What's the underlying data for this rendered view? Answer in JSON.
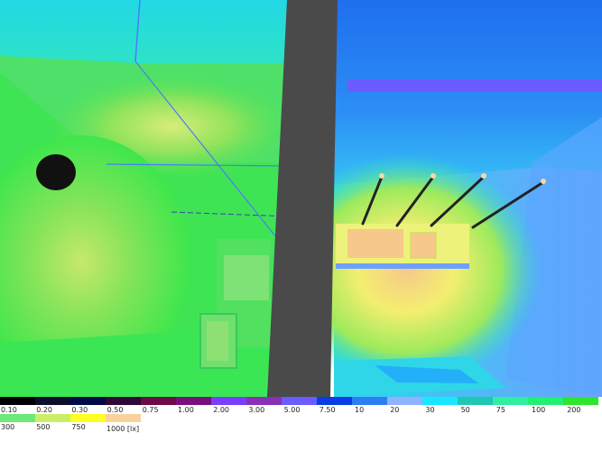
{
  "legend": {
    "unit_label": "1000 [lx]",
    "row1": [
      {
        "label": "0.10",
        "color": "#000000"
      },
      {
        "label": "0.20",
        "color": "#0d0d2e"
      },
      {
        "label": "0.30",
        "color": "#000a46"
      },
      {
        "label": "0.50",
        "color": "#2e0836"
      },
      {
        "label": "0.75",
        "color": "#6c0a48"
      },
      {
        "label": "1.00",
        "color": "#7b0f7a"
      },
      {
        "label": "2.00",
        "color": "#7a3cff"
      },
      {
        "label": "3.00",
        "color": "#8a2fb8"
      },
      {
        "label": "5.00",
        "color": "#6a5cff"
      },
      {
        "label": "7.50",
        "color": "#0a3ce6"
      },
      {
        "label": "10",
        "color": "#2f7df5"
      },
      {
        "label": "20",
        "color": "#8fb3ff"
      },
      {
        "label": "30",
        "color": "#19e6ff"
      },
      {
        "label": "50",
        "color": "#1fc8b0"
      },
      {
        "label": "75",
        "color": "#2ef0a0"
      },
      {
        "label": "100",
        "color": "#22f072"
      },
      {
        "label": "200",
        "color": "#2ee62e"
      }
    ],
    "row2": [
      {
        "label": "300",
        "color": "#6ee87a"
      },
      {
        "label": "500",
        "color": "#ccee66"
      },
      {
        "label": "750",
        "color": "#ffff22"
      },
      {
        "label": "",
        "color": "#f8d29a"
      }
    ]
  }
}
